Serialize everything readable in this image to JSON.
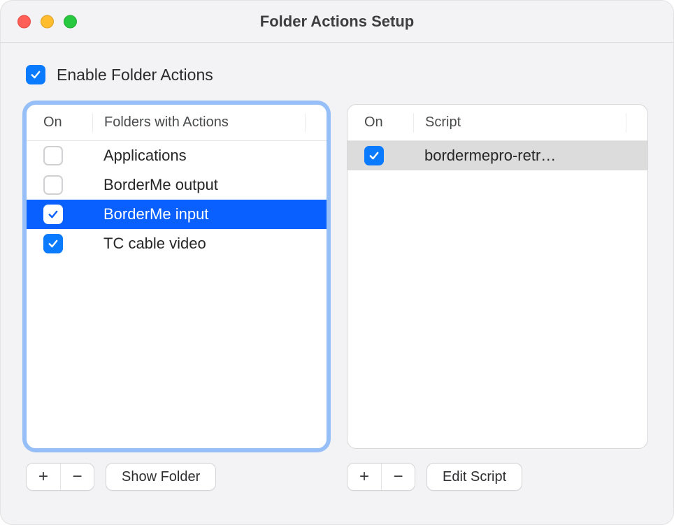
{
  "window": {
    "title": "Folder Actions Setup"
  },
  "enable": {
    "label": "Enable Folder Actions",
    "checked": true
  },
  "folders": {
    "headers": {
      "on": "On",
      "name": "Folders with Actions"
    },
    "items": [
      {
        "on": false,
        "name": "Applications",
        "selected": false
      },
      {
        "on": false,
        "name": "BorderMe output",
        "selected": false
      },
      {
        "on": true,
        "name": "BorderMe input",
        "selected": true
      },
      {
        "on": true,
        "name": "TC cable video",
        "selected": false
      }
    ],
    "buttons": {
      "add": "+",
      "remove": "−",
      "show": "Show Folder"
    }
  },
  "scripts": {
    "headers": {
      "on": "On",
      "name": "Script"
    },
    "items": [
      {
        "on": true,
        "name": "bordermepro-retr…",
        "selected": true
      }
    ],
    "buttons": {
      "add": "+",
      "remove": "−",
      "edit": "Edit Script"
    }
  }
}
